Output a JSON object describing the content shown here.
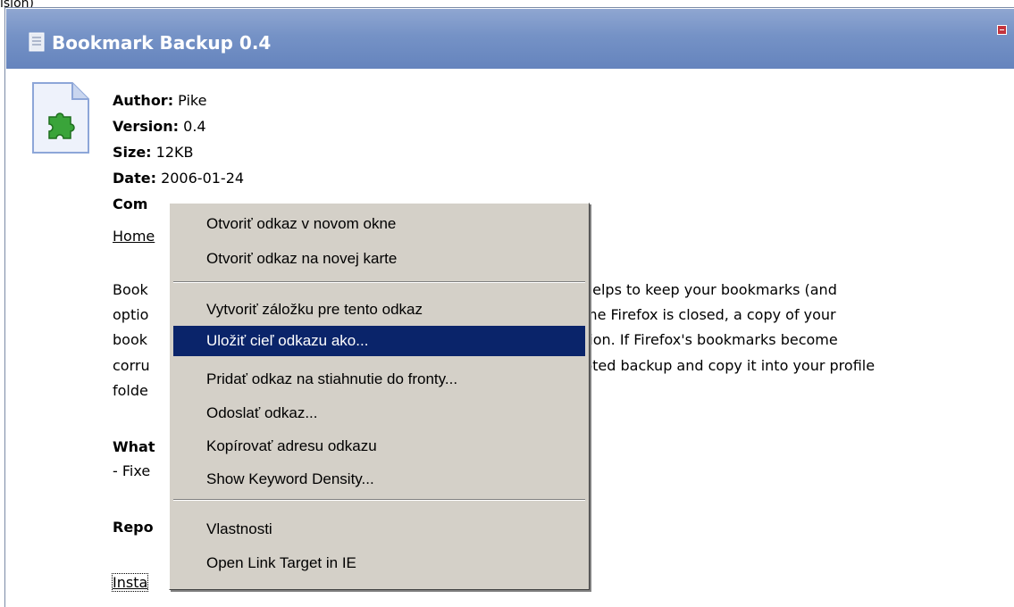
{
  "top_partial_text": "ision)",
  "panel": {
    "title": "Bookmark Backup 0.4"
  },
  "meta": {
    "author_label": "Author:",
    "author_value": " Pike",
    "version_label": "Version:",
    "version_value": " 0.4",
    "size_label": "Size:",
    "size_value": " 12KB",
    "date_label": "Date:",
    "date_value": " 2006-01-24",
    "compat_label": "Com"
  },
  "homepage_link": "Home",
  "description": {
    "line1_start": "Book",
    "line1_end": "helps to keep your bookmarks (and",
    "line2_start": "optio",
    "line2_end": "me Firefox is closed, a copy of your",
    "line3_start": "book",
    "line3_end": "tion. If Firefox's bookmarks become",
    "line4_start": "corru",
    "line4_end": "pted backup and copy it into your profile",
    "line5_start": "folde"
  },
  "whats_new_label": "What",
  "whats_new_item": "- Fixe",
  "report_label": "Repo",
  "install_link": "Insta",
  "context_menu": {
    "items": [
      "Otvoriť odkaz v novom okne",
      "Otvoriť odkaz na novej karte",
      "Vytvoriť záložku pre tento odkaz",
      "Uložiť cieľ odkazu ako...",
      "Pridať odkaz na stiahnutie do fronty...",
      "Odoslať odkaz...",
      "Kopírovať adresu odkazu",
      "Show Keyword Density...",
      "Vlastnosti",
      "Open Link Target in IE"
    ],
    "selected_index": 3
  },
  "colors": {
    "header_bg": "#7592c6",
    "menu_bg": "#d4d0c8",
    "menu_selected_bg": "#0a246a"
  }
}
